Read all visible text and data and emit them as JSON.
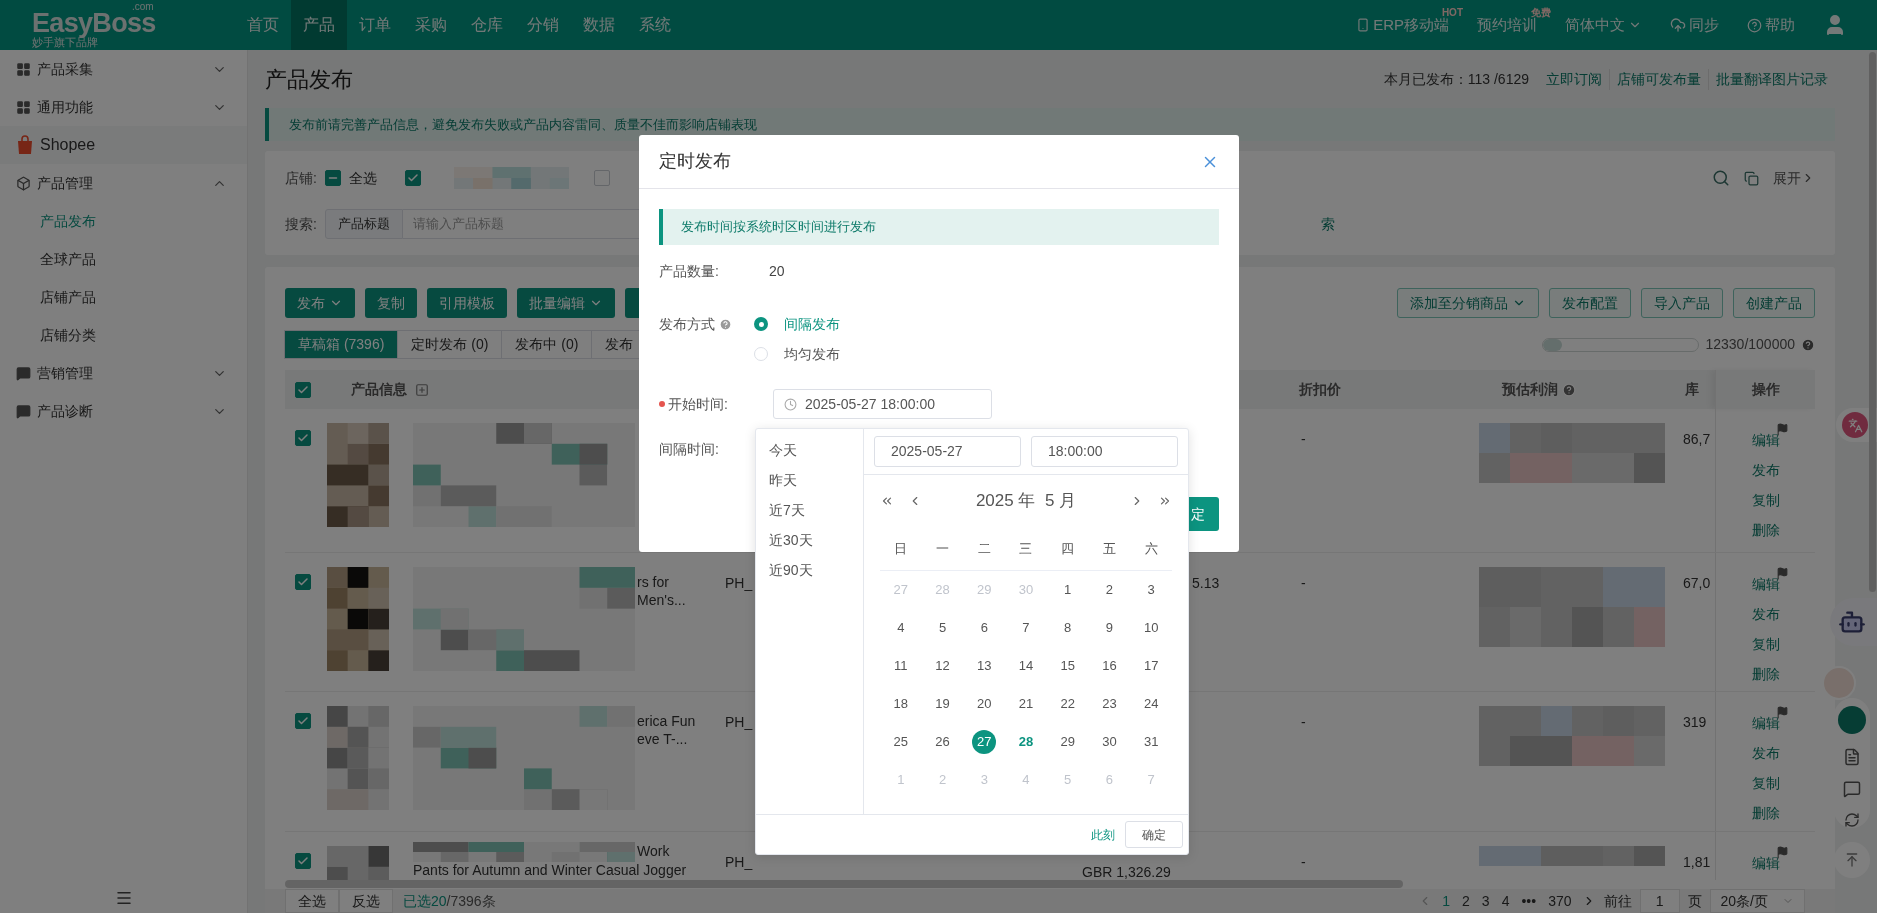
{
  "header": {
    "logo": "EasyBoss",
    "logo_suffix": ".com",
    "tagline": "妙手旗下品牌",
    "nav": [
      {
        "label": "首页",
        "selected": false
      },
      {
        "label": "产品",
        "selected": true
      },
      {
        "label": "订单",
        "selected": false
      },
      {
        "label": "采购",
        "selected": false
      },
      {
        "label": "仓库",
        "selected": false
      },
      {
        "label": "分销",
        "selected": false
      },
      {
        "label": "数据",
        "selected": false
      },
      {
        "label": "系统",
        "selected": false
      }
    ],
    "actions": [
      {
        "kind": "mobile",
        "label": "ERP移动端",
        "badge": "HOT"
      },
      {
        "kind": "training",
        "label": "预约培训",
        "badge": "免费"
      },
      {
        "kind": "language",
        "label": "简体中文"
      },
      {
        "kind": "sync",
        "label": "同步"
      },
      {
        "kind": "help",
        "label": "帮助"
      },
      {
        "kind": "user"
      }
    ]
  },
  "sidebar": {
    "items": [
      {
        "kind": "grid",
        "label": "产品采集",
        "expanded": false
      },
      {
        "kind": "grid",
        "label": "通用功能",
        "expanded": false
      },
      {
        "kind": "shopee",
        "label": "Shopee"
      },
      {
        "kind": "box",
        "label": "产品管理",
        "expanded": true,
        "children": [
          {
            "label": "产品发布",
            "selected": true
          },
          {
            "label": "全球产品",
            "selected": false
          },
          {
            "label": "店铺产品",
            "selected": false
          },
          {
            "label": "店铺分类",
            "selected": false
          }
        ]
      },
      {
        "kind": "chat",
        "label": "营销管理",
        "expanded": false
      },
      {
        "kind": "chat",
        "label": "产品诊断",
        "expanded": false
      }
    ]
  },
  "page": {
    "title": "产品发布",
    "quota_label": "本月已发布：",
    "quota_value": "113 /6129",
    "links": [
      "立即订阅",
      "店铺可发布量",
      "批量翻译图片记录"
    ],
    "notice": "发布前请完善产品信息，避免发布失败或产品内容雷同、质量不佳而影响店铺表现"
  },
  "filters": {
    "shop_label": "店铺:",
    "select_all": {
      "label": "全选",
      "indeterminate": true
    },
    "shops": [
      {
        "checked": true
      },
      {
        "checked": false
      }
    ],
    "search_label": "搜索:",
    "search_prefix": "产品标题",
    "search_placeholder": "请输入产品标题",
    "search_button_tail": "索",
    "expand": "展开"
  },
  "toolbar": {
    "left": [
      {
        "label": "发布",
        "dropdown": true
      },
      {
        "label": "复制",
        "dropdown": false
      },
      {
        "label": "引用模板",
        "dropdown": false
      },
      {
        "label": "批量编辑",
        "dropdown": true
      }
    ],
    "right": [
      {
        "label": "添加至分销商品",
        "dropdown": true
      },
      {
        "label": "发布配置",
        "dropdown": false
      },
      {
        "label": "导入产品",
        "dropdown": false
      },
      {
        "label": "创建产品",
        "dropdown": false
      }
    ]
  },
  "tabs": [
    {
      "label": "草稿箱 (7396)",
      "selected": true
    },
    {
      "label": "定时发布 (0)",
      "selected": false
    },
    {
      "label": "发布中 (0)",
      "selected": false
    },
    {
      "label": "发布",
      "selected": false
    }
  ],
  "usage": {
    "level": 0.12,
    "text": "12330/100000"
  },
  "table": {
    "checked": true,
    "product": "产品信息",
    "discount": "折扣价",
    "profit": "预估利润",
    "stock": "库",
    "actions": "操作",
    "rows": [
      {
        "checked": true,
        "discount": "-",
        "stock": "86,7",
        "actions": [
          "编辑",
          "发布",
          "复制",
          "删除"
        ]
      },
      {
        "checked": true,
        "title_tail": "rs for Men's...",
        "sku": "PH_",
        "price_tail": "5.13",
        "discount": "-",
        "stock": "67,0",
        "actions": [
          "编辑",
          "发布",
          "复制",
          "删除"
        ]
      },
      {
        "checked": true,
        "title_tail": "erica Fun eve T-...",
        "sku": "PH_",
        "discount": "-",
        "stock": "319",
        "actions": [
          "编辑",
          "发布",
          "复制",
          "删除"
        ]
      },
      {
        "checked": true,
        "title_tail": "Work",
        "title_line": "Pants for Autumn and Winter Casual Jogger",
        "sku": "PH_",
        "price": "GBR 1,326.29",
        "discount": "-",
        "stock": "1,81",
        "actions": [
          "编辑"
        ]
      }
    ]
  },
  "footer": {
    "select_all": "全选",
    "invert": "反选",
    "selected": "已选20",
    "total": "/7396条",
    "pages": [
      {
        "label": "1",
        "selected": true
      },
      {
        "label": "2",
        "selected": false
      },
      {
        "label": "3",
        "selected": false
      },
      {
        "label": "4",
        "selected": false
      },
      {
        "label": "•••",
        "selected": false
      },
      {
        "label": "370",
        "selected": false
      }
    ],
    "goto_label": "前往",
    "goto_value": "1",
    "page_suffix": "页",
    "page_size": "20条/页"
  },
  "modal": {
    "title": "定时发布",
    "notice": "发布时间按系统时区时间进行发布",
    "count_label": "产品数量:",
    "count": "20",
    "mode_label": "发布方式",
    "modes": [
      {
        "label": "间隔发布",
        "selected": true
      },
      {
        "label": "均匀发布",
        "selected": false
      }
    ],
    "start_label": "开始时间:",
    "start_required": true,
    "start_value": "2025-05-27 18:00:00",
    "interval_label": "间隔时间:",
    "confirm_tail": "定"
  },
  "picker": {
    "shortcuts": [
      "今天",
      "昨天",
      "近7天",
      "近30天",
      "近90天"
    ],
    "date_value": "2025-05-27",
    "time_value": "18:00:00",
    "month_title": "2025 年  5 月",
    "weekdays": [
      "日",
      "一",
      "二",
      "三",
      "四",
      "五",
      "六"
    ],
    "days": [
      {
        "d": "27",
        "kind": "other",
        "selected": false,
        "today": false
      },
      {
        "d": "28",
        "kind": "other",
        "selected": false,
        "today": false
      },
      {
        "d": "29",
        "kind": "other",
        "selected": false,
        "today": false
      },
      {
        "d": "30",
        "kind": "other",
        "selected": false,
        "today": false
      },
      {
        "d": "1",
        "kind": "current",
        "selected": false,
        "today": false
      },
      {
        "d": "2",
        "kind": "current",
        "selected": false,
        "today": false
      },
      {
        "d": "3",
        "kind": "current",
        "selected": false,
        "today": false
      },
      {
        "d": "4",
        "kind": "current",
        "selected": false,
        "today": false
      },
      {
        "d": "5",
        "kind": "current",
        "selected": false,
        "today": false
      },
      {
        "d": "6",
        "kind": "current",
        "selected": false,
        "today": false
      },
      {
        "d": "7",
        "kind": "current",
        "selected": false,
        "today": false
      },
      {
        "d": "8",
        "kind": "current",
        "selected": false,
        "today": false
      },
      {
        "d": "9",
        "kind": "current",
        "selected": false,
        "today": false
      },
      {
        "d": "10",
        "kind": "current",
        "selected": false,
        "today": false
      },
      {
        "d": "11",
        "kind": "current",
        "selected": false,
        "today": false
      },
      {
        "d": "12",
        "kind": "current",
        "selected": false,
        "today": false
      },
      {
        "d": "13",
        "kind": "current",
        "selected": false,
        "today": false
      },
      {
        "d": "14",
        "kind": "current",
        "selected": false,
        "today": false
      },
      {
        "d": "15",
        "kind": "current",
        "selected": false,
        "today": false
      },
      {
        "d": "16",
        "kind": "current",
        "selected": false,
        "today": false
      },
      {
        "d": "17",
        "kind": "current",
        "selected": false,
        "today": false
      },
      {
        "d": "18",
        "kind": "current",
        "selected": false,
        "today": false
      },
      {
        "d": "19",
        "kind": "current",
        "selected": false,
        "today": false
      },
      {
        "d": "20",
        "kind": "current",
        "selected": false,
        "today": false
      },
      {
        "d": "21",
        "kind": "current",
        "selected": false,
        "today": false
      },
      {
        "d": "22",
        "kind": "current",
        "selected": false,
        "today": false
      },
      {
        "d": "23",
        "kind": "current",
        "selected": false,
        "today": false
      },
      {
        "d": "24",
        "kind": "current",
        "selected": false,
        "today": false
      },
      {
        "d": "25",
        "kind": "current",
        "selected": false,
        "today": false
      },
      {
        "d": "26",
        "kind": "current",
        "selected": false,
        "today": false
      },
      {
        "d": "27",
        "kind": "current",
        "selected": true,
        "today": false
      },
      {
        "d": "28",
        "kind": "current",
        "selected": false,
        "today": true
      },
      {
        "d": "29",
        "kind": "current",
        "selected": false,
        "today": false
      },
      {
        "d": "30",
        "kind": "current",
        "selected": false,
        "today": false
      },
      {
        "d": "31",
        "kind": "current",
        "selected": false,
        "today": false
      },
      {
        "d": "1",
        "kind": "other",
        "selected": false,
        "today": false
      },
      {
        "d": "2",
        "kind": "other",
        "selected": false,
        "today": false
      },
      {
        "d": "3",
        "kind": "other",
        "selected": false,
        "today": false
      },
      {
        "d": "4",
        "kind": "other",
        "selected": false,
        "today": false
      },
      {
        "d": "5",
        "kind": "other",
        "selected": false,
        "today": false
      },
      {
        "d": "6",
        "kind": "other",
        "selected": false,
        "today": false
      },
      {
        "d": "7",
        "kind": "other",
        "selected": false,
        "today": false
      }
    ],
    "now_label": "此刻",
    "ok_label": "确定"
  }
}
